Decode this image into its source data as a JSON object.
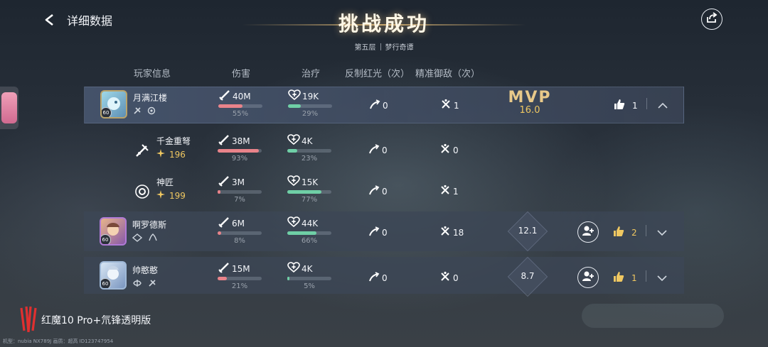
{
  "header": {
    "back_label": "详细数据",
    "title": "挑战成功",
    "subtitle_left": "第五层",
    "subtitle_right": "梦行奇谭"
  },
  "columns": {
    "player": "玩家信息",
    "damage": "伤害",
    "heal": "治疗",
    "counter": "反制红光（次）",
    "precise": "精准御敌（次）"
  },
  "mvp": {
    "label": "MVP",
    "score": "16.0"
  },
  "players": [
    {
      "name": "月满江楼",
      "level": "60",
      "damage": "40M",
      "damage_pct": "55%",
      "damage_frac": 0.55,
      "heal": "19K",
      "heal_pct": "29%",
      "heal_frac": 0.29,
      "counter": "0",
      "precise": "1",
      "likes": "1"
    },
    {
      "name": "千金重弩",
      "score": "196",
      "damage": "38M",
      "damage_pct": "93%",
      "damage_frac": 0.93,
      "heal": "4K",
      "heal_pct": "23%",
      "heal_frac": 0.23,
      "counter": "0",
      "precise": "0"
    },
    {
      "name": "神匠",
      "score": "199",
      "damage": "3M",
      "damage_pct": "7%",
      "damage_frac": 0.07,
      "heal": "15K",
      "heal_pct": "77%",
      "heal_frac": 0.77,
      "counter": "0",
      "precise": "1"
    },
    {
      "name": "啊罗德斯",
      "level": "60",
      "damage": "6M",
      "damage_pct": "8%",
      "damage_frac": 0.08,
      "heal": "44K",
      "heal_pct": "66%",
      "heal_frac": 0.66,
      "counter": "0",
      "precise": "18",
      "rating": "12.1",
      "likes": "2"
    },
    {
      "name": "帅憨憨",
      "level": "60",
      "damage": "15M",
      "damage_pct": "21%",
      "damage_frac": 0.21,
      "heal": "4K",
      "heal_pct": "5%",
      "heal_frac": 0.05,
      "counter": "0",
      "precise": "0",
      "rating": "8.7",
      "likes": "1"
    }
  ],
  "footer": {
    "device_name": "红魔10 Pro+氘锋透明版",
    "device_info": "机型：nubia NX789J 画质：超高 ID123747954"
  },
  "colors": {
    "damage": "#e9838a",
    "heal": "#6fcfa6",
    "gold": "#f0c861"
  },
  "icons": [
    "back-arrow-icon",
    "share-icon",
    "sword-icon",
    "heal-heart-icon",
    "counter-icon",
    "precise-icon",
    "add-friend-icon",
    "thumbs-up-icon",
    "chevron-up-icon",
    "chevron-down-icon"
  ]
}
